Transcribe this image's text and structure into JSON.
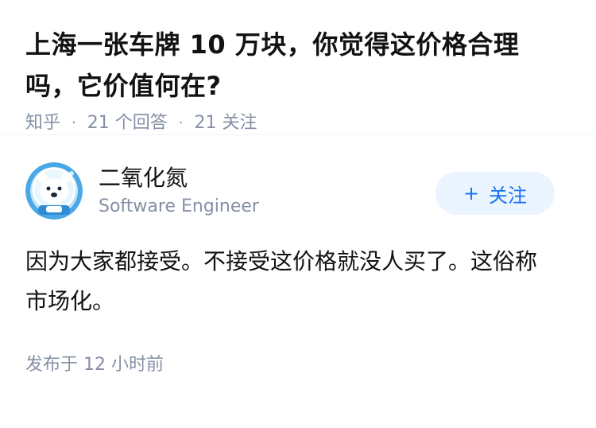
{
  "question": {
    "title": "上海一张车牌 10 万块，你觉得这价格合理吗，它价值何在?",
    "source": "知乎",
    "answers_count": "21 个回答",
    "followers_count": "21 关注"
  },
  "answer": {
    "author": {
      "name": "二氧化氮",
      "headline": "Software Engineer",
      "avatar_icon": "polar-bear-astronaut-avatar"
    },
    "follow_button": {
      "icon": "+",
      "label": "关注"
    },
    "content": "因为大家都接受。不接受这价格就没人买了。这俗称市场化。",
    "time": "发布于  12 小时前"
  },
  "colors": {
    "meta_text": "#8590a6",
    "primary_text": "#121212",
    "follow_bg": "#ebf5ff",
    "follow_text": "#1772f6"
  }
}
